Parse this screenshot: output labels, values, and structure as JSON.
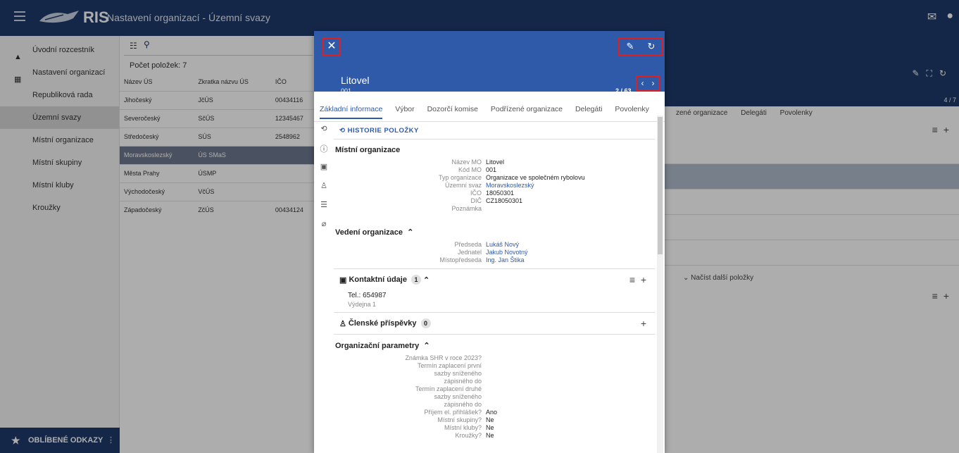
{
  "header": {
    "app_name": "RIS",
    "page_title": "Nastavení organizací - Územní svazy",
    "icons": [
      "mail-icon",
      "user-icon"
    ]
  },
  "sidebar": {
    "items": [
      {
        "label": "Úvodní rozcestník",
        "icon": "home-icon"
      },
      {
        "label": "Nastavení organizací",
        "icon": "grid-icon"
      },
      {
        "label": "Republiková rada"
      },
      {
        "label": "Územní svazy",
        "active": true
      },
      {
        "label": "Místní organizace"
      },
      {
        "label": "Místní skupiny"
      },
      {
        "label": "Místní kluby"
      },
      {
        "label": "Kroužky"
      }
    ],
    "favorites": "OBLÍBENÉ ODKAZY"
  },
  "list": {
    "count": "Počet položek: 7",
    "columns": [
      "Název ÚS",
      "Zkratka názvu ÚS",
      "IČO"
    ],
    "rows": [
      [
        "Jihočeský",
        "JčÚS",
        "00434116"
      ],
      [
        "Severočeský",
        "SčÚS",
        "12345467"
      ],
      [
        "Středočeský",
        "SÚS",
        "2548962"
      ],
      [
        "Moravskoslezský",
        "ÚS SMaS",
        ""
      ],
      [
        "Města Prahy",
        "ÚSMP",
        ""
      ],
      [
        "Východočeský",
        "VčÚS",
        ""
      ],
      [
        "Západočeský",
        "ZčÚS",
        "00434124"
      ]
    ]
  },
  "background": {
    "pager": "4 / 7",
    "tabs": [
      "zené organizace",
      "Delegáti",
      "Povolenky"
    ],
    "load_more": "Načíst další položky"
  },
  "modal": {
    "title": "Litovel",
    "subtitle": "001",
    "nav": "2 / 63",
    "tabs": [
      "Základní informace",
      "Výbor",
      "Dozorčí komise",
      "Podřízené organizace",
      "Delegáti",
      "Povolenky"
    ],
    "history": "HISTORIE POLOŽKY",
    "org_title": "Místní organizace",
    "org_fields": [
      {
        "k": "Název MO",
        "v": "Litovel"
      },
      {
        "k": "Kód MO",
        "v": "001"
      },
      {
        "k": "Typ organizace",
        "v": "Organizace ve společném rybolovu"
      },
      {
        "k": "Územní svaz",
        "v": "Moravskoslezský",
        "link": true
      },
      {
        "k": "IČO",
        "v": "18050301"
      },
      {
        "k": "DIČ",
        "v": "CZ18050301"
      },
      {
        "k": "Poznámka",
        "v": ""
      }
    ],
    "mgmt_title": "Vedení organizace",
    "mgmt_fields": [
      {
        "k": "Předseda",
        "v": "Lukáš Nový"
      },
      {
        "k": "Jednatel",
        "v": "Jakub Novotný"
      },
      {
        "k": "Místopředseda",
        "v": "Ing. Jan Štika"
      }
    ],
    "contact_title": "Kontaktní údaje",
    "contact_count": "1",
    "contact_phone": "Tel.: 654987",
    "contact_note": "Výdejna 1",
    "fees_title": "Členské příspěvky",
    "fees_count": "0",
    "params_title": "Organizační parametry",
    "params_fields": [
      {
        "k": "Známka SHR v roce 2023?",
        "v": ""
      },
      {
        "k": "Termín zaplacení první sazby sníženého zápisného do",
        "v": ""
      },
      {
        "k": "Termín zaplacení druhé sazby sníženého zápisného do",
        "v": ""
      },
      {
        "k": "Příjem el. přihlášek?",
        "v": "Ano"
      },
      {
        "k": "Místní skupiny?",
        "v": "Ne"
      },
      {
        "k": "Místní kluby?",
        "v": "Ne"
      },
      {
        "k": "Kroužky?",
        "v": "Ne"
      }
    ]
  }
}
